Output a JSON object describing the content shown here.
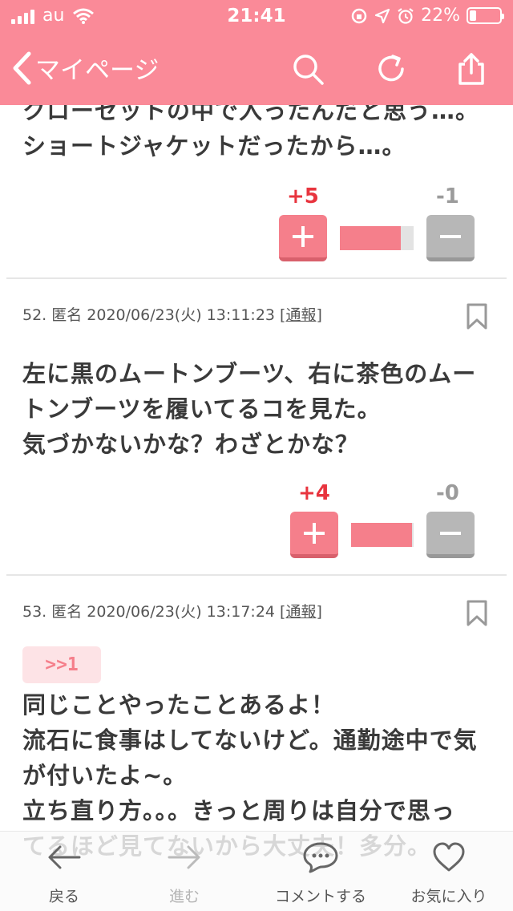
{
  "status_bar": {
    "carrier": "au",
    "time": "21:41",
    "battery": "22%"
  },
  "navbar": {
    "back_label": "マイページ",
    "icons": [
      "search-icon",
      "reload-icon",
      "share-icon"
    ]
  },
  "posts": [
    {
      "body": "クローゼットの中で入ったんだと思う…。\nショートジャケットだったから…。",
      "plus": "+5",
      "minus": "-1",
      "ratio": 0.83
    },
    {
      "meta": "52. 匿名 2020/06/23(火) 13:11:23 ",
      "report": "[通報]",
      "body": "左に黒のムートンブーツ、右に茶色のムー\nトンブーツを履いてるコを見た。\n気づかないかな？わざとかな？",
      "plus": "+4",
      "minus": "-0",
      "ratio": 0.97
    },
    {
      "meta": "53. 匿名 2020/06/23(火) 13:17:24 ",
      "report": "[通報]",
      "anchor": ">>1",
      "body": "同じことやったことあるよ！\n流石に食事はしてないけど。通勤途中で気\nが付いたよ~。\n立ち直り方。。。きっと周りは自分で思っ\nてるほど見てないから大丈夫！多分。"
    }
  ],
  "toolbar": {
    "back": "戻る",
    "forward": "進む",
    "comment": "コメントする",
    "favorite": "お気に入り"
  },
  "colors": {
    "accent": "#fa8a98",
    "plus": "#f57f8b",
    "plus_count": "#e8343e",
    "minus": "#b7b7b7"
  }
}
